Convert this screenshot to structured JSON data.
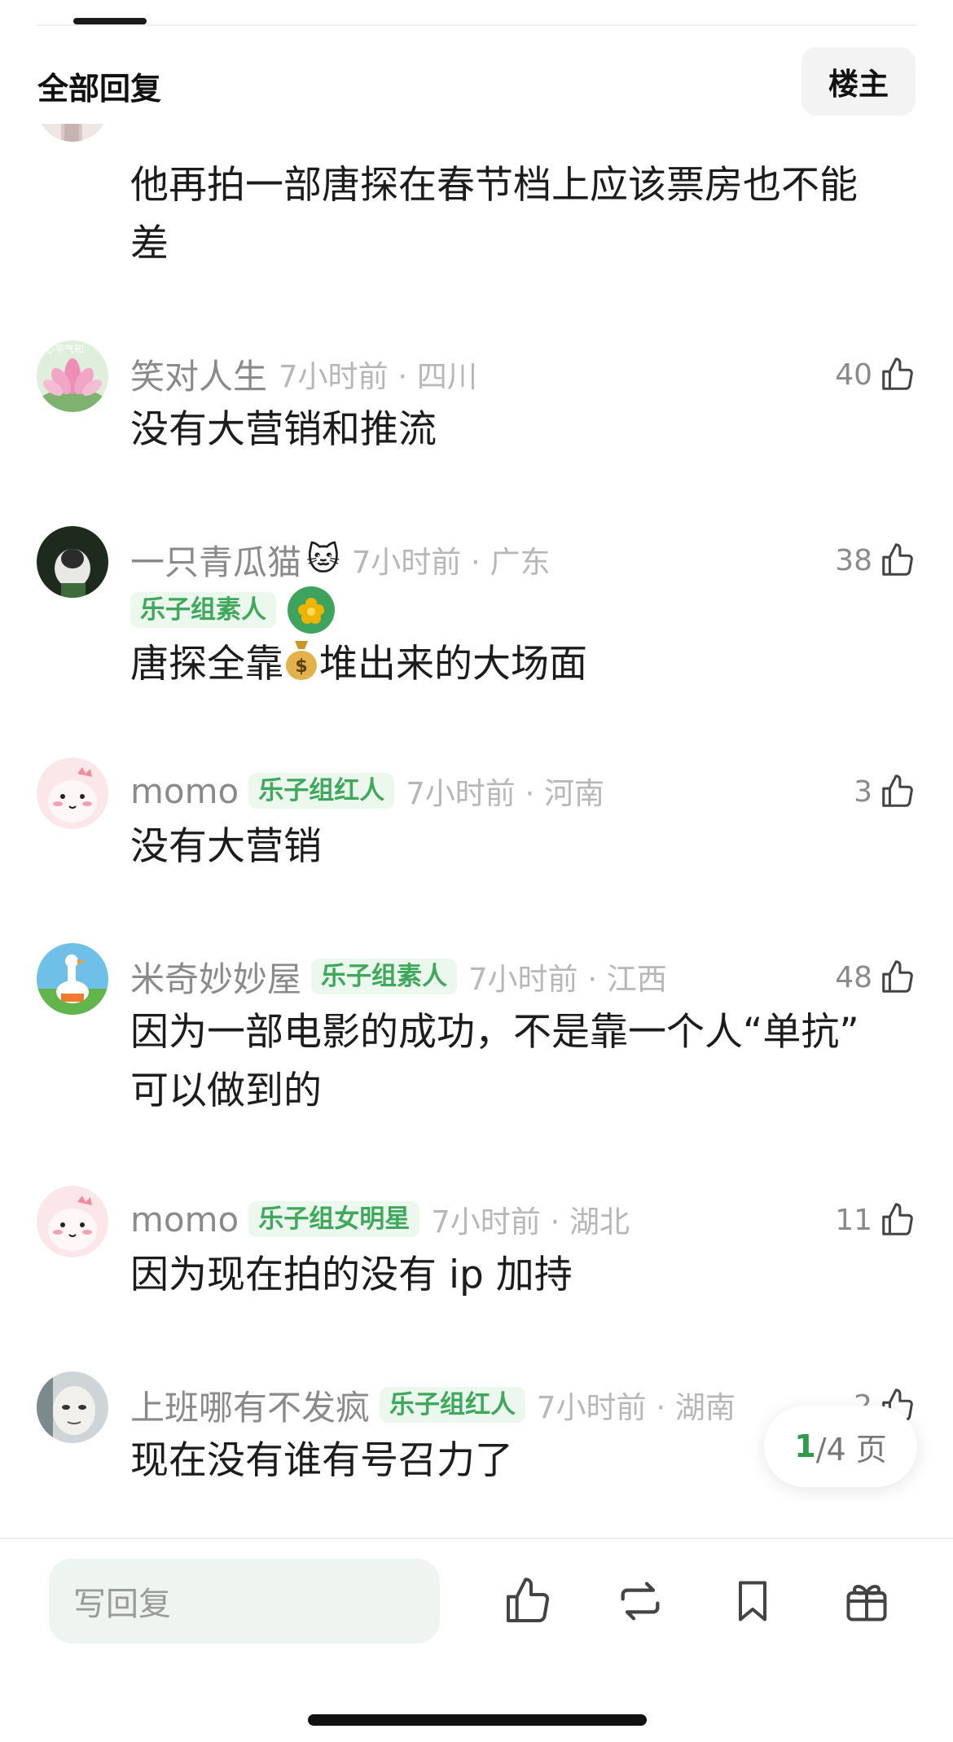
{
  "header": {
    "title": "全部回复",
    "op_button": "楼主"
  },
  "comments": [
    {
      "text_line1": "他再拍一部唐探在春节档上应该票房也不能",
      "text_line2": "差"
    },
    {
      "username": "笑对人生",
      "time_location": "7小时前 · 四川",
      "likes": "40",
      "text": "没有大营销和推流",
      "avatar_text": "心平气和"
    },
    {
      "username": "一只青瓜猫",
      "emoji": "🐱",
      "badge": "乐子组素人",
      "time_location": "7小时前 · 广东",
      "likes": "38",
      "text_before": "唐探全靠",
      "text_after": "堆出来的大场面"
    },
    {
      "username": "momo",
      "badge": "乐子组红人",
      "time_location": "7小时前 · 河南",
      "likes": "3",
      "text": "没有大营销"
    },
    {
      "username": "米奇妙妙屋",
      "badge": "乐子组素人",
      "time_location": "7小时前 · 江西",
      "likes": "48",
      "text_line1": "因为一部电影的成功，不是靠一个人“单抗”",
      "text_line2": "可以做到的"
    },
    {
      "username": "momo",
      "badge": "乐子组女明星",
      "time_location": "7小时前 · 湖北",
      "likes": "11",
      "text": "因为现在拍的没有 ip 加持"
    },
    {
      "username": "上班哪有不发疯",
      "badge": "乐子组红人",
      "time_location": "7小时前 · 湖南",
      "likes": "2",
      "text": "现在没有谁有号召力了"
    }
  ],
  "pager": {
    "current": "1",
    "total": "/4 页"
  },
  "bottom_bar": {
    "reply_placeholder": "写回复",
    "icons": [
      "thumbs-up-icon",
      "repost-icon",
      "bookmark-icon",
      "gift-icon"
    ]
  },
  "colors": {
    "accent_green": "#3fa85c",
    "badge_bg": "#ecf7ee",
    "reply_bg": "#eef5f0"
  }
}
